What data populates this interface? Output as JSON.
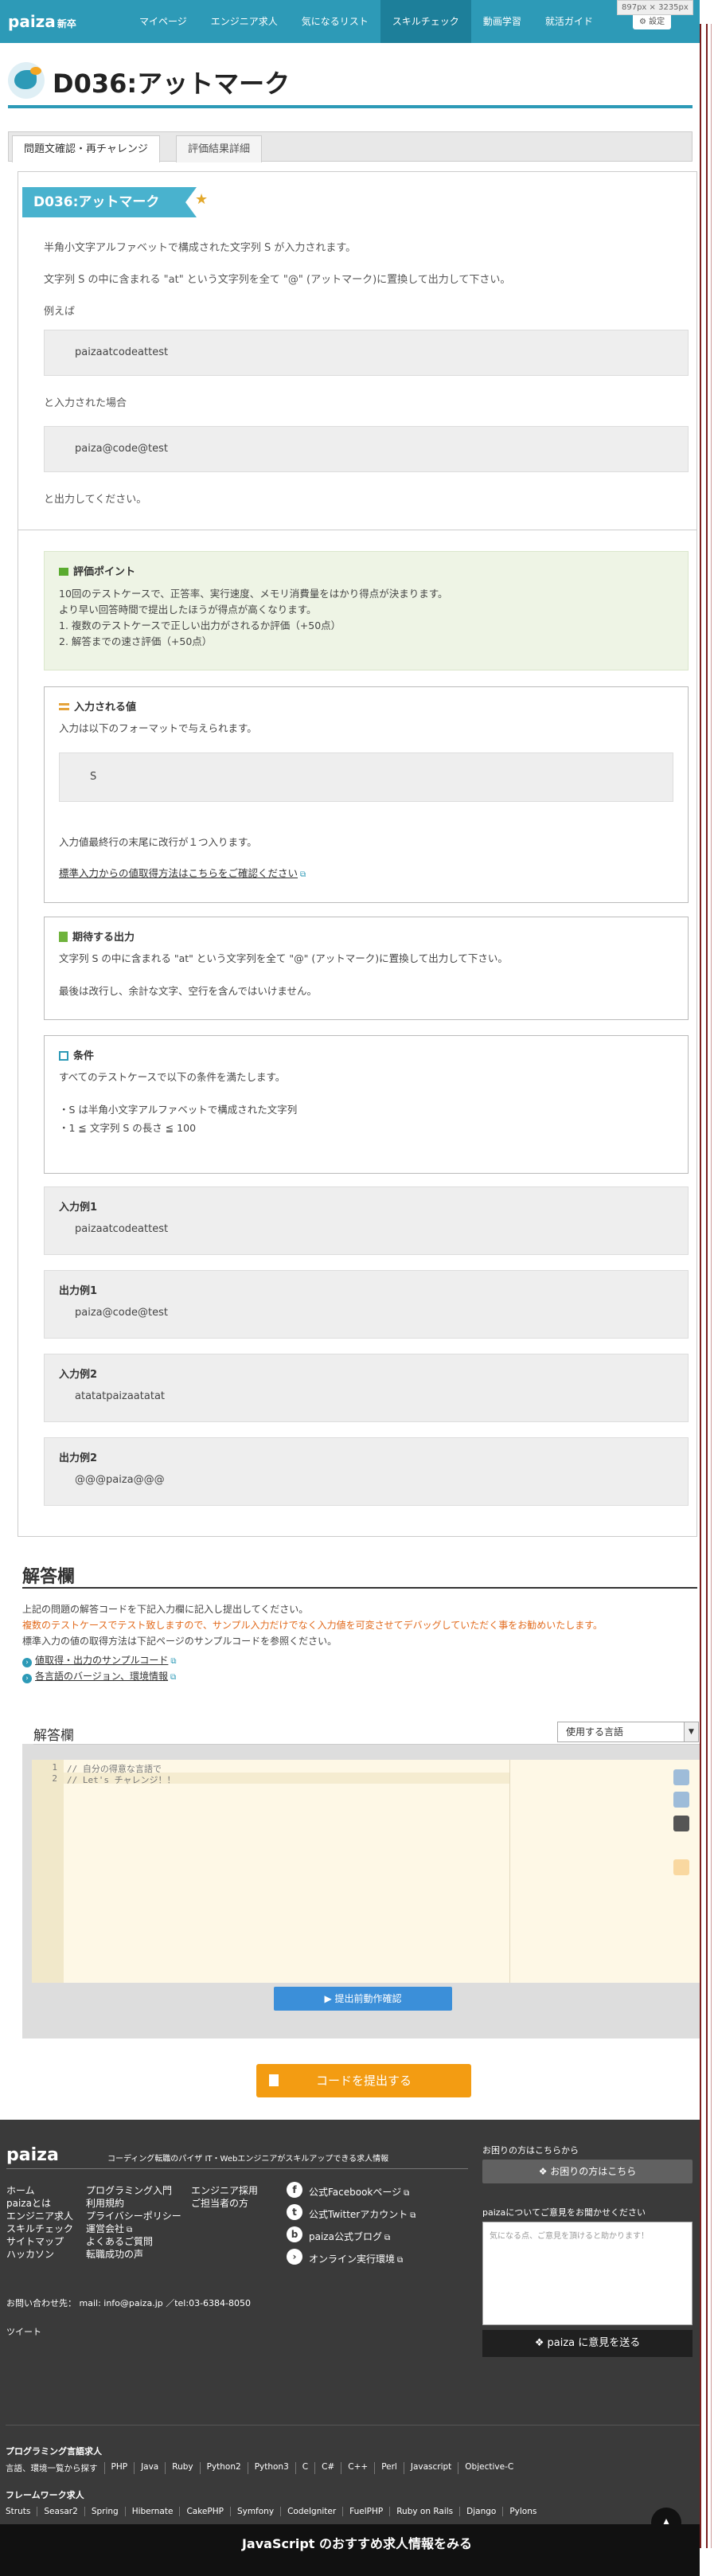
{
  "size_badge": "897px × 3235px",
  "nav": {
    "logo": "paiza",
    "logo_new": "新卒",
    "items": [
      "マイページ",
      "エンジニア求人",
      "気になるリスト",
      "スキルチェック",
      "動画学習",
      "就活ガイド"
    ],
    "settings": "設定"
  },
  "title": "D036:アットマーク",
  "tabs": [
    "問題文確認・再チャレンジ",
    "評価結果詳細"
  ],
  "problem": {
    "ribbon": "D036:アットマーク",
    "p1": "半角小文字アルファベットで構成された文字列 S が入力されます。",
    "p2": "文字列 S の中に含まれる \"at\" という文字列を全て \"@\" (アットマーク)に置換して出力して下さい。",
    "p3": "例えば",
    "ex_in": "paizaatcodeattest",
    "p4": "と入力された場合",
    "ex_out": "paiza@code@test",
    "p5": "と出力してください。"
  },
  "eval": {
    "title": "評価ポイント",
    "lines": [
      "10回のテストケースで、正答率、実行速度、メモリ消費量をはかり得点が決まります。",
      "より早い回答時間で提出したほうが得点が高くなります。",
      "1.  複数のテストケースで正しい出力がされるか評価（+50点）",
      "2.  解答までの速さ評価（+50点）"
    ]
  },
  "input_sec": {
    "title": "入力される値",
    "desc": "入力は以下のフォーマットで与えられます。",
    "format": "S",
    "note": "入力値最終行の末尾に改行が１つ入ります。",
    "link": "標準入力からの値取得方法はこちらをご確認ください"
  },
  "output_sec": {
    "title": "期待する出力",
    "l1": "文字列 S の中に含まれる \"at\" という文字列を全て \"@\" (アットマーク)に置換して出力して下さい。",
    "l2": "最後は改行し、余計な文字、空行を含んではいけません。"
  },
  "cond_sec": {
    "title": "条件",
    "l1": "すべてのテストケースで以下の条件を満たします。",
    "l2": "・S は半角小文字アルファベットで構成された文字列",
    "l3": "・1 ≦ 文字列 S の長さ ≦ 100"
  },
  "examples": [
    {
      "label": "入力例1",
      "value": "paizaatcodeattest"
    },
    {
      "label": "出力例1",
      "value": "paiza@code@test"
    },
    {
      "label": "入力例2",
      "value": "atatatpaizaatatat"
    },
    {
      "label": "出力例2",
      "value": "@@@paiza@@@"
    }
  ],
  "answer": {
    "title": "解答欄",
    "p1": "上記の問題の解答コードを下記入力欄に記入し提出してください。",
    "p2": "複数のテストケースでテスト致しますので、サンプル入力だけでなく入力値を可変させてデバッグしていただく事をお勧めいたします。",
    "p3": "標準入力の値の取得方法は下記ページのサンプルコードを参照ください。",
    "link1": "値取得・出力のサンプルコード",
    "link2": "各言語のバージョン、環境情報",
    "editor_title": "解答欄",
    "lang_select": "使用する言語",
    "code": [
      "// 自分の得意な言語で",
      "// Let's チャレンジ！！"
    ],
    "run_btn": "提出前動作確認",
    "submit_btn": "コードを提出する"
  },
  "footer": {
    "logo": "paiza",
    "tagline": "コーディング転職のパイザ  IT・Webエンジニアがスキルアップできる求人情報",
    "col1": [
      "ホーム",
      "paizaとは",
      "エンジニア求人",
      "スキルチェック",
      "サイトマップ",
      "ハッカソン"
    ],
    "col2": [
      "プログラミング入門",
      "利用規約",
      "プライバシーポリシー",
      "運営会社",
      "よくあるご質問",
      "転職成功の声"
    ],
    "col3": [
      "エンジニア採用",
      "ご担当者の方"
    ],
    "social": [
      "公式Facebookページ",
      "公式Twitterアカウント",
      "paiza公式ブログ",
      "オンライン実行環境"
    ],
    "contact": "お問い合わせ先： mail: info@paiza.jp ／tel:03-6384-8050",
    "tweet": "ツイート",
    "ask_label": "お困りの方はこちらから",
    "ask_btn": "お困りの方はこちら",
    "fb_label": "paizaについてご意見をお聞かせください",
    "fb_placeholder": "気になる点、ご意見を頂けると助かります！",
    "send_btn": "paiza に意見を送る",
    "lang_title": "プログラミング言語求人",
    "langs": [
      "言語、環境一覧から探す",
      "PHP",
      "Java",
      "Ruby",
      "Python2",
      "Python3",
      "C",
      "C#",
      "C++",
      "Perl",
      "Javascript",
      "Objective-C"
    ],
    "fw_title": "フレームワーク求人",
    "fws": [
      "Struts",
      "Seasar2",
      "Spring",
      "Hibernate",
      "CakePHP",
      "Symfony",
      "CodeIgniter",
      "FuelPHP",
      "Ruby on Rails",
      "Django",
      "Pylons"
    ],
    "js_banner": "JavaScript のおすすめ求人情報をみる"
  }
}
